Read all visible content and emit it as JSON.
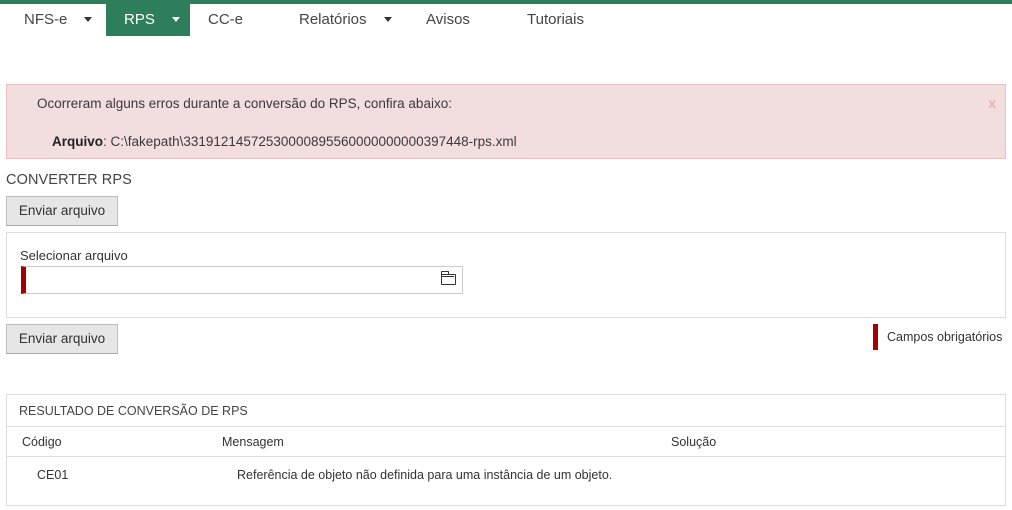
{
  "nav": {
    "items": [
      {
        "label": "NFS-e",
        "dropdown": true,
        "active": false
      },
      {
        "label": "RPS",
        "dropdown": true,
        "active": true
      },
      {
        "label": "CC-e",
        "dropdown": false,
        "active": false
      },
      {
        "label": "Relatórios",
        "dropdown": true,
        "active": false
      },
      {
        "label": "Avisos",
        "dropdown": false,
        "active": false
      },
      {
        "label": "Tutoriais",
        "dropdown": false,
        "active": false
      }
    ]
  },
  "alert": {
    "message": "Ocorreram alguns erros durante a conversão do RPS, confira abaixo:",
    "file_label": "Arquivo",
    "file_separator": ": ",
    "file_path": "C:\\fakepath\\33191214572530000895560000000000397448-rps.xml",
    "close_symbol": "x"
  },
  "converter": {
    "title": "CONVERTER RPS",
    "send_button_top": "Enviar arquivo",
    "send_button_bottom": "Enviar arquivo",
    "select_file_label": "Selecionar arquivo",
    "file_value": "",
    "required_note": "Campos obrigatórios"
  },
  "results": {
    "title": "RESULTADO DE CONVERSÃO DE RPS",
    "columns": [
      "Código",
      "Mensagem",
      "Solução"
    ],
    "rows": [
      {
        "code": "CE01",
        "message": "Referência de objeto não definida para uma instância de um objeto.",
        "solution": ""
      }
    ]
  },
  "colors": {
    "brand_green": "#2e7d5b",
    "alert_bg": "#f2dede",
    "required_red": "#a50000"
  },
  "icons": {
    "folder": "folder-icon",
    "caret": "caret-down-icon",
    "close": "close-icon"
  }
}
